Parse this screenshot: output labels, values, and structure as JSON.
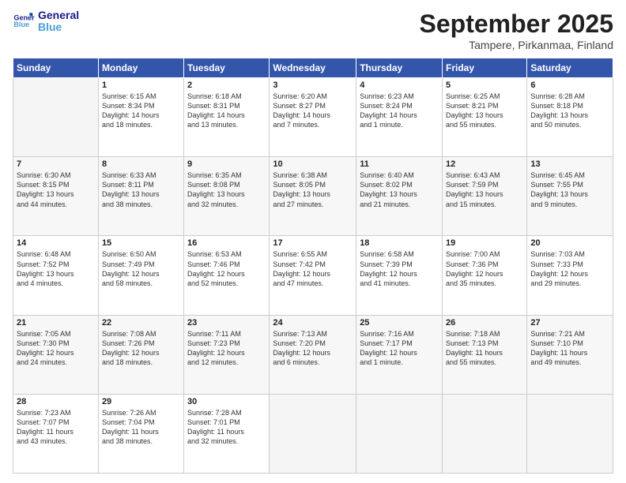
{
  "logo": {
    "text1": "General",
    "text2": "Blue"
  },
  "title": "September 2025",
  "location": "Tampere, Pirkanmaa, Finland",
  "weekdays": [
    "Sunday",
    "Monday",
    "Tuesday",
    "Wednesday",
    "Thursday",
    "Friday",
    "Saturday"
  ],
  "weeks": [
    [
      {
        "day": "",
        "info": ""
      },
      {
        "day": "1",
        "info": "Sunrise: 6:15 AM\nSunset: 8:34 PM\nDaylight: 14 hours\nand 18 minutes."
      },
      {
        "day": "2",
        "info": "Sunrise: 6:18 AM\nSunset: 8:31 PM\nDaylight: 14 hours\nand 13 minutes."
      },
      {
        "day": "3",
        "info": "Sunrise: 6:20 AM\nSunset: 8:27 PM\nDaylight: 14 hours\nand 7 minutes."
      },
      {
        "day": "4",
        "info": "Sunrise: 6:23 AM\nSunset: 8:24 PM\nDaylight: 14 hours\nand 1 minute."
      },
      {
        "day": "5",
        "info": "Sunrise: 6:25 AM\nSunset: 8:21 PM\nDaylight: 13 hours\nand 55 minutes."
      },
      {
        "day": "6",
        "info": "Sunrise: 6:28 AM\nSunset: 8:18 PM\nDaylight: 13 hours\nand 50 minutes."
      }
    ],
    [
      {
        "day": "7",
        "info": "Sunrise: 6:30 AM\nSunset: 8:15 PM\nDaylight: 13 hours\nand 44 minutes."
      },
      {
        "day": "8",
        "info": "Sunrise: 6:33 AM\nSunset: 8:11 PM\nDaylight: 13 hours\nand 38 minutes."
      },
      {
        "day": "9",
        "info": "Sunrise: 6:35 AM\nSunset: 8:08 PM\nDaylight: 13 hours\nand 32 minutes."
      },
      {
        "day": "10",
        "info": "Sunrise: 6:38 AM\nSunset: 8:05 PM\nDaylight: 13 hours\nand 27 minutes."
      },
      {
        "day": "11",
        "info": "Sunrise: 6:40 AM\nSunset: 8:02 PM\nDaylight: 13 hours\nand 21 minutes."
      },
      {
        "day": "12",
        "info": "Sunrise: 6:43 AM\nSunset: 7:59 PM\nDaylight: 13 hours\nand 15 minutes."
      },
      {
        "day": "13",
        "info": "Sunrise: 6:45 AM\nSunset: 7:55 PM\nDaylight: 13 hours\nand 9 minutes."
      }
    ],
    [
      {
        "day": "14",
        "info": "Sunrise: 6:48 AM\nSunset: 7:52 PM\nDaylight: 13 hours\nand 4 minutes."
      },
      {
        "day": "15",
        "info": "Sunrise: 6:50 AM\nSunset: 7:49 PM\nDaylight: 12 hours\nand 58 minutes."
      },
      {
        "day": "16",
        "info": "Sunrise: 6:53 AM\nSunset: 7:46 PM\nDaylight: 12 hours\nand 52 minutes."
      },
      {
        "day": "17",
        "info": "Sunrise: 6:55 AM\nSunset: 7:42 PM\nDaylight: 12 hours\nand 47 minutes."
      },
      {
        "day": "18",
        "info": "Sunrise: 6:58 AM\nSunset: 7:39 PM\nDaylight: 12 hours\nand 41 minutes."
      },
      {
        "day": "19",
        "info": "Sunrise: 7:00 AM\nSunset: 7:36 PM\nDaylight: 12 hours\nand 35 minutes."
      },
      {
        "day": "20",
        "info": "Sunrise: 7:03 AM\nSunset: 7:33 PM\nDaylight: 12 hours\nand 29 minutes."
      }
    ],
    [
      {
        "day": "21",
        "info": "Sunrise: 7:05 AM\nSunset: 7:30 PM\nDaylight: 12 hours\nand 24 minutes."
      },
      {
        "day": "22",
        "info": "Sunrise: 7:08 AM\nSunset: 7:26 PM\nDaylight: 12 hours\nand 18 minutes."
      },
      {
        "day": "23",
        "info": "Sunrise: 7:11 AM\nSunset: 7:23 PM\nDaylight: 12 hours\nand 12 minutes."
      },
      {
        "day": "24",
        "info": "Sunrise: 7:13 AM\nSunset: 7:20 PM\nDaylight: 12 hours\nand 6 minutes."
      },
      {
        "day": "25",
        "info": "Sunrise: 7:16 AM\nSunset: 7:17 PM\nDaylight: 12 hours\nand 1 minute."
      },
      {
        "day": "26",
        "info": "Sunrise: 7:18 AM\nSunset: 7:13 PM\nDaylight: 11 hours\nand 55 minutes."
      },
      {
        "day": "27",
        "info": "Sunrise: 7:21 AM\nSunset: 7:10 PM\nDaylight: 11 hours\nand 49 minutes."
      }
    ],
    [
      {
        "day": "28",
        "info": "Sunrise: 7:23 AM\nSunset: 7:07 PM\nDaylight: 11 hours\nand 43 minutes."
      },
      {
        "day": "29",
        "info": "Sunrise: 7:26 AM\nSunset: 7:04 PM\nDaylight: 11 hours\nand 38 minutes."
      },
      {
        "day": "30",
        "info": "Sunrise: 7:28 AM\nSunset: 7:01 PM\nDaylight: 11 hours\nand 32 minutes."
      },
      {
        "day": "",
        "info": ""
      },
      {
        "day": "",
        "info": ""
      },
      {
        "day": "",
        "info": ""
      },
      {
        "day": "",
        "info": ""
      }
    ]
  ]
}
